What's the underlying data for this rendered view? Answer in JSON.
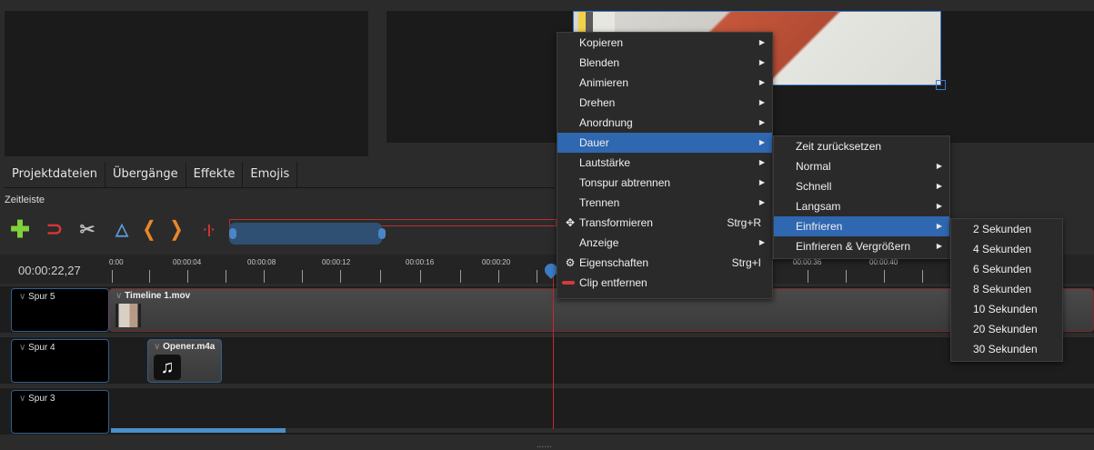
{
  "tabs": [
    "Projektdateien",
    "Übergänge",
    "Effekte",
    "Emojis"
  ],
  "timeline_title": "Zeitleiste",
  "timecode": "00:00:22,27",
  "ruler_labels": [
    "0:00",
    "00:00:04",
    "00:00:08",
    "00:00:12",
    "00:00:16",
    "00:00:20",
    "00:00:36",
    "00:00:40"
  ],
  "toolbar_icons": [
    "add-track-icon",
    "snap-magnet-icon",
    "razor-icon",
    "add-marker-icon",
    "previous-marker-icon",
    "next-marker-icon",
    "center-playhead-icon"
  ],
  "tracks": [
    {
      "label": "Spur 5",
      "clip": "Timeline 1.mov"
    },
    {
      "label": "Spur 4",
      "clip": "Opener.m4a"
    },
    {
      "label": "Spur 3",
      "clip": ""
    }
  ],
  "context_menu": {
    "items": [
      {
        "label": "Kopieren",
        "submenu": true
      },
      {
        "label": "Blenden",
        "submenu": true
      },
      {
        "label": "Animieren",
        "submenu": true
      },
      {
        "label": "Drehen",
        "submenu": true
      },
      {
        "label": "Anordnung",
        "submenu": true
      },
      {
        "label": "Dauer",
        "submenu": true,
        "selected": true
      },
      {
        "label": "Lautstärke",
        "submenu": true
      },
      {
        "label": "Tonspur abtrennen",
        "submenu": true
      },
      {
        "label": "Trennen",
        "submenu": true
      },
      {
        "label": "Transformieren",
        "shortcut": "Strg+R",
        "icon": "move-icon"
      },
      {
        "label": "Anzeige",
        "submenu": true
      },
      {
        "label": "Eigenschaften",
        "shortcut": "Strg+I",
        "icon": "gear-icon"
      },
      {
        "label": "Clip entfernen",
        "icon": "remove-icon"
      }
    ]
  },
  "dauer_menu": {
    "items": [
      {
        "label": "Zeit zurücksetzen",
        "submenu": false
      },
      {
        "label": "Normal",
        "submenu": true
      },
      {
        "label": "Schnell",
        "submenu": true
      },
      {
        "label": "Langsam",
        "submenu": true
      },
      {
        "label": "Einfrieren",
        "submenu": true,
        "selected": true
      },
      {
        "label": "Einfrieren & Vergrößern",
        "submenu": true
      }
    ]
  },
  "einfrieren_menu": {
    "items": [
      "2 Sekunden",
      "4 Sekunden",
      "6 Sekunden",
      "8 Sekunden",
      "10 Sekunden",
      "20 Sekunden",
      "30 Sekunden"
    ]
  },
  "colors": {
    "selection": "#2f67b0",
    "playhead": "#c72a2a",
    "accent": "#4a8fc7"
  }
}
